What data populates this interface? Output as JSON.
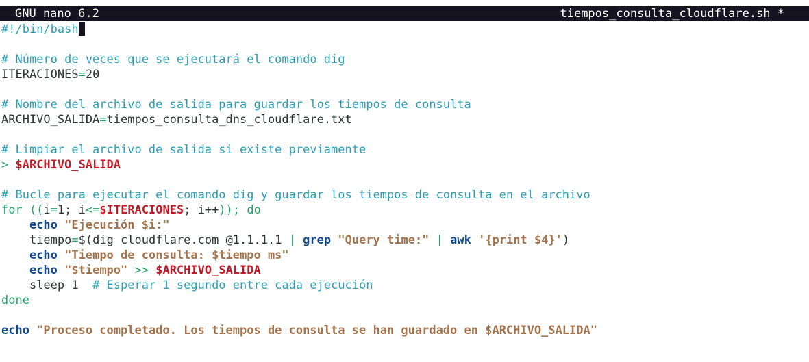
{
  "titlebar": {
    "app": "GNU nano 6.2",
    "filename": "tiempos_consulta_cloudflare.sh *"
  },
  "colors": {
    "titlebar_bg": "#171421",
    "comment": "#2a9fb6",
    "keyword_green": "#26a269",
    "variable_red": "#c01c28",
    "builtin_blue": "#12488b",
    "string_brown": "#a2734c"
  },
  "editor": {
    "shebang": "#!/bin/bash",
    "comment_iter": "# Número de veces que se ejecutará el comando dig",
    "iter_name": "ITERACIONES",
    "iter_eq": "=",
    "iter_val": "20",
    "comment_out": "# Nombre del archivo de salida para guardar los tiempos de consulta",
    "out_name": "ARCHIVO_SALIDA",
    "out_eq": "=",
    "out_val": "tiempos_consulta_dns_cloudflare.txt",
    "comment_clear": "# Limpiar el archivo de salida si existe previamente",
    "clear_op": "> ",
    "clear_var": "$ARCHIVO_SALIDA",
    "comment_loop": "# Bucle para ejecutar el comando dig y guardar los tiempos de consulta en el archivo",
    "for_kw": "for ((",
    "for_i1": "i",
    "for_eq": "=",
    "for_one": "1; ",
    "for_i2": "i",
    "for_le": "<=",
    "for_var": "$ITERACIONES",
    "for_semi": "; ",
    "for_inc": "i++",
    "for_end": ")); do",
    "indent": "    ",
    "echo1_kw": "echo",
    "echo1_str": " \"Ejecución $i:\"",
    "tiempo_name": "tiempo",
    "tiempo_eq": "=",
    "tiempo_sub": "$(",
    "dig_cmd": "dig cloudflare.com @1.1.1.1 ",
    "pipe1": "| ",
    "grep_kw": "grep",
    "grep_str": " \"Query time:\"",
    "pipe2": " | ",
    "awk_kw": "awk",
    "awk_str": " '{print $4}'",
    "tiempo_close": ")",
    "echo2_kw": "echo",
    "echo2_str": " \"Tiempo de consulta: $tiempo ms\"",
    "echo3_kw": "echo",
    "echo3_str": " \"$tiempo\"",
    "echo3_redir": " >> ",
    "echo3_var": "$ARCHIVO_SALIDA",
    "sleep_cmd": "sleep 1  ",
    "sleep_comment": "# Esperar 1 segundo entre cada ejecución",
    "done_kw": "done",
    "final_echo_kw": "echo",
    "final_echo_str": " \"Proceso completado. Los tiempos de consulta se han guardado en $ARCHIVO_SALIDA\""
  }
}
